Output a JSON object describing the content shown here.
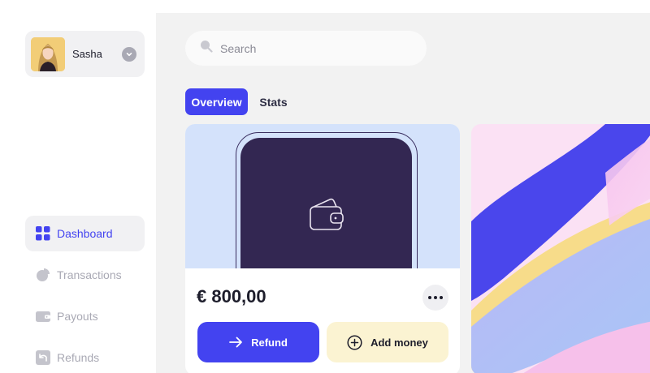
{
  "user": {
    "name": "Sasha"
  },
  "search": {
    "placeholder": "Search"
  },
  "tabs": [
    {
      "label": "Overview",
      "active": true
    },
    {
      "label": "Stats",
      "active": false
    }
  ],
  "nav": {
    "items": [
      {
        "label": "Dashboard",
        "icon": "grid-icon",
        "active": true
      },
      {
        "label": "Transactions",
        "icon": "pie-chart-icon",
        "active": false
      },
      {
        "label": "Payouts",
        "icon": "wallet-icon",
        "active": false
      },
      {
        "label": "Refunds",
        "icon": "refund-icon",
        "active": false
      }
    ]
  },
  "wallet": {
    "balance": "€ 800,00",
    "refund_label": "Refund",
    "add_money_label": "Add money"
  },
  "colors": {
    "accent": "#4343f0",
    "phone": "#332752",
    "card_top": "#d4e2fb",
    "add_money_bg": "#fbf3d2"
  }
}
